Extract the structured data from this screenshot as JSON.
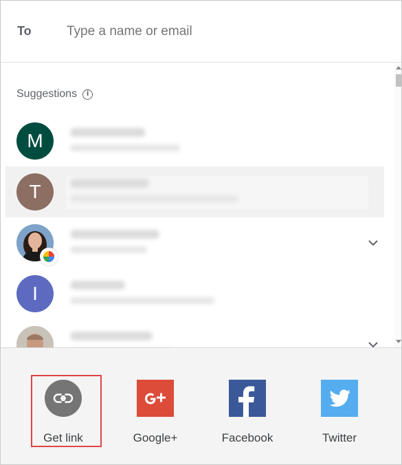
{
  "to_field": {
    "label": "To",
    "placeholder": "Type a name or email",
    "value": ""
  },
  "suggestions": {
    "title": "Suggestions",
    "info_icon": "info-icon",
    "contacts": [
      {
        "initial": "M",
        "color": "#004d40",
        "type": "initial",
        "has_chevron": false,
        "highlighted": false
      },
      {
        "initial": "T",
        "color": "#8d6e63",
        "type": "initial",
        "has_chevron": false,
        "highlighted": true
      },
      {
        "initial": "",
        "color": "#6d8fb5",
        "type": "photo",
        "badge": "google-photos-icon",
        "has_chevron": true,
        "highlighted": false
      },
      {
        "initial": "I",
        "color": "#5c6bc0",
        "type": "initial",
        "has_chevron": false,
        "highlighted": false
      },
      {
        "initial": "",
        "color": "#b0a79a",
        "type": "photo",
        "has_chevron": true,
        "highlighted": false
      }
    ]
  },
  "share_options": [
    {
      "label": "Get link",
      "icon": "link-icon",
      "color": "#757575",
      "selected": true
    },
    {
      "label": "Google+",
      "icon": "google-plus-icon",
      "color": "#dd4b39",
      "selected": false
    },
    {
      "label": "Facebook",
      "icon": "facebook-icon",
      "color": "#3b5998",
      "selected": false
    },
    {
      "label": "Twitter",
      "icon": "twitter-icon",
      "color": "#55acee",
      "selected": false
    }
  ]
}
